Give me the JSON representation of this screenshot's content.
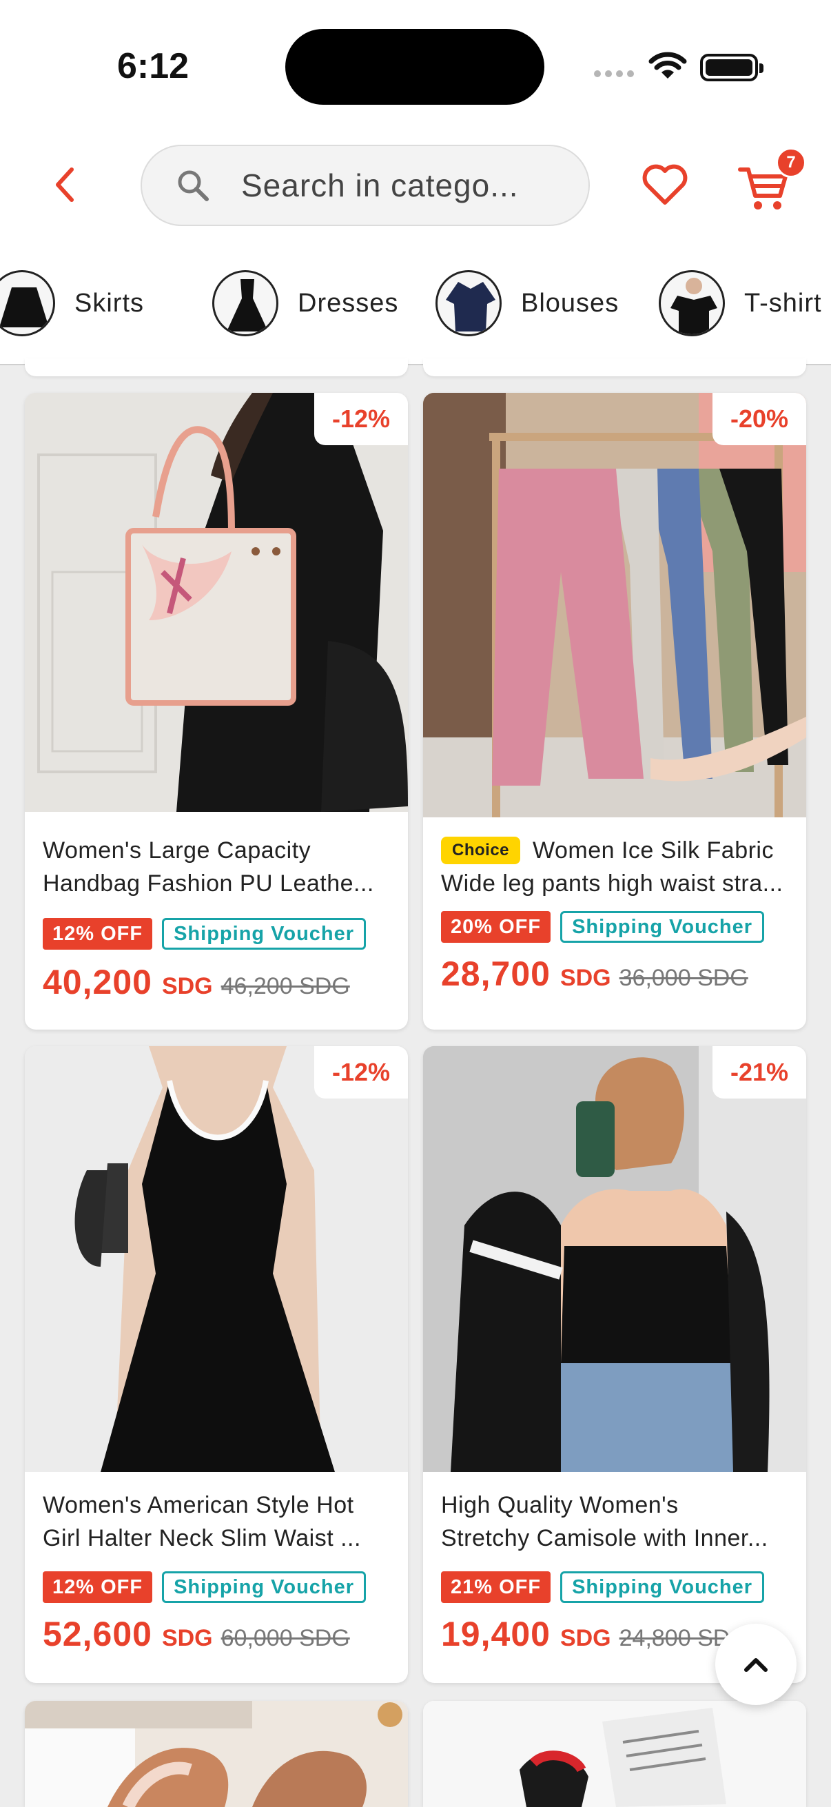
{
  "status_bar": {
    "time": "6:12"
  },
  "header": {
    "search_placeholder": "Search in catego...",
    "cart_count": "7",
    "accent_color": "#e8412b"
  },
  "categories": [
    {
      "label": "Skirts",
      "icon": "skirt-thumbnail"
    },
    {
      "label": "Dresses",
      "icon": "dress-thumbnail"
    },
    {
      "label": "Blouses",
      "icon": "blouse-thumbnail"
    },
    {
      "label": "T-shirt",
      "icon": "tshirt-thumbnail"
    }
  ],
  "products": [
    {
      "discount_tag": "-12%",
      "choice": "",
      "title_line1": "Women's Large Capacity",
      "title_line2": "Handbag Fashion PU Leathe...",
      "off_badge": "12% OFF",
      "voucher": "Shipping Voucher",
      "price": "40,200",
      "currency": "SDG",
      "old_price": "46,200 SDG"
    },
    {
      "discount_tag": "-20%",
      "choice": "Choice",
      "title_line1": "Women Ice Silk Fabric",
      "title_line2": "Wide leg pants high waist stra...",
      "off_badge": "20% OFF",
      "voucher": "Shipping Voucher",
      "price": "28,700",
      "currency": "SDG",
      "old_price": "36,000 SDG"
    },
    {
      "discount_tag": "-12%",
      "choice": "",
      "title_line1": "Women's American Style Hot",
      "title_line2": "Girl Halter Neck Slim Waist ...",
      "off_badge": "12% OFF",
      "voucher": "Shipping Voucher",
      "price": "52,600",
      "currency": "SDG",
      "old_price": "60,000 SDG"
    },
    {
      "discount_tag": "-21%",
      "choice": "",
      "title_line1": "High Quality Women's",
      "title_line2": "Stretchy Camisole with Inner...",
      "off_badge": "21% OFF",
      "voucher": "Shipping Voucher",
      "price": "19,400",
      "currency": "SDG",
      "old_price": "24,800 SDG"
    }
  ]
}
